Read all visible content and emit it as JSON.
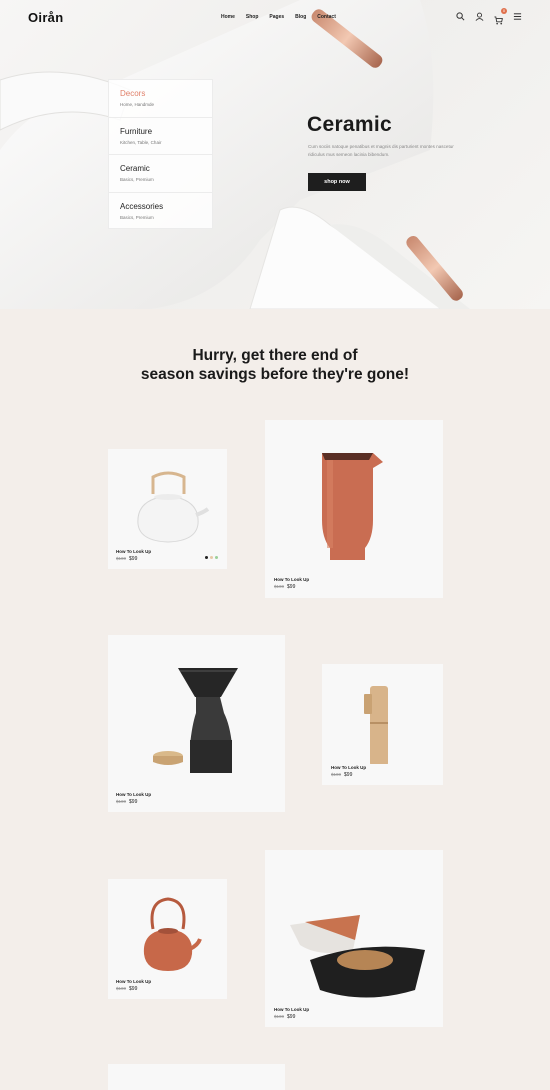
{
  "header": {
    "logo": "Oirån",
    "nav": [
      "Home",
      "Shop",
      "Pages",
      "Blog",
      "Contact"
    ],
    "cart_count": "0"
  },
  "categories": [
    {
      "title": "Decors",
      "sub": "Home, Handmde"
    },
    {
      "title": "Furniture",
      "sub": "Kitchen, Table, Chair"
    },
    {
      "title": "Ceramic",
      "sub": "Basics, Premium"
    },
    {
      "title": "Accessories",
      "sub": "Basics, Premium"
    }
  ],
  "hero": {
    "title": "Ceramic",
    "description": "Cum sociis natoque penatibus et magnis dis parturient montes nascetur ridiculus mus semeon lacinia bibendum.",
    "button": "shop now"
  },
  "section": {
    "heading_line1": "Hurry, get there end of",
    "heading_line2": "season savings before they're gone!"
  },
  "products": [
    {
      "name": "How To Look Up",
      "old_price": "$100",
      "price": "$99"
    },
    {
      "name": "How To Look Up",
      "old_price": "$100",
      "price": "$99"
    },
    {
      "name": "How To Look Up",
      "old_price": "$100",
      "price": "$99"
    },
    {
      "name": "How To Look Up",
      "old_price": "$100",
      "price": "$99"
    },
    {
      "name": "How To Look Up",
      "old_price": "$100",
      "price": "$99"
    },
    {
      "name": "How To Look Up",
      "old_price": "$100",
      "price": "$99"
    }
  ],
  "colors": {
    "accent": "#e0704c",
    "dark": "#1e1e1e",
    "background": "#f3eeea"
  }
}
